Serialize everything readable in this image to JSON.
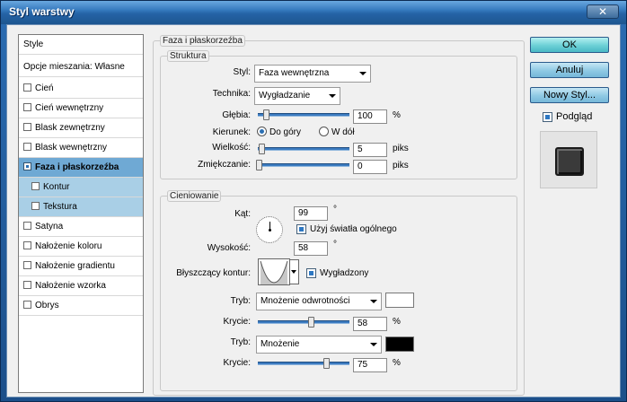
{
  "window": {
    "title": "Styl warstwy",
    "close_symbol": "✕"
  },
  "list": {
    "header": "Style",
    "blending": "Opcje mieszania: Własne",
    "items": [
      {
        "label": "Cień"
      },
      {
        "label": "Cień wewnętrzny"
      },
      {
        "label": "Blask zewnętrzny"
      },
      {
        "label": "Blask wewnętrzny"
      },
      {
        "label": "Faza i płaskorzeźba"
      },
      {
        "label": "Kontur"
      },
      {
        "label": "Tekstura"
      },
      {
        "label": "Satyna"
      },
      {
        "label": "Nałożenie koloru"
      },
      {
        "label": "Nałożenie gradientu"
      },
      {
        "label": "Nałożenie wzorka"
      },
      {
        "label": "Obrys"
      }
    ]
  },
  "bevel": {
    "title": "Faza i płaskorzeźba",
    "structure": {
      "title": "Struktura",
      "style_label": "Styl:",
      "style_value": "Faza wewnętrzna",
      "technique_label": "Technika:",
      "technique_value": "Wygładzanie",
      "depth_label": "Głębia:",
      "depth_value": "100",
      "depth_unit": "%",
      "direction_label": "Kierunek:",
      "dir_up": "Do góry",
      "dir_down": "W dół",
      "size_label": "Wielkość:",
      "size_value": "5",
      "size_unit": "piks",
      "soften_label": "Zmiękczanie:",
      "soften_value": "0",
      "soften_unit": "piks"
    },
    "shading": {
      "title": "Cieniowanie",
      "angle_label": "Kąt:",
      "angle_value": "99",
      "angle_unit": "°",
      "global_light_label": "Użyj światła ogólnego",
      "altitude_label": "Wysokość:",
      "altitude_value": "58",
      "altitude_unit": "°",
      "gloss_label": "Błyszczący kontur:",
      "antialiased_label": "Wygładzony",
      "highlight_mode_label": "Tryb:",
      "highlight_mode_value": "Mnożenie odwrotności",
      "highlight_opacity_label": "Krycie:",
      "highlight_opacity_value": "58",
      "highlight_opacity_unit": "%",
      "shadow_mode_label": "Tryb:",
      "shadow_mode_value": "Mnożenie",
      "shadow_opacity_label": "Krycie:",
      "shadow_opacity_value": "75",
      "shadow_opacity_unit": "%",
      "highlight_color": "#ffffff",
      "shadow_color": "#000000"
    }
  },
  "buttons": {
    "ok": "OK",
    "cancel": "Anuluj",
    "new_style": "Nowy Styl...",
    "preview_label": "Podgląd"
  }
}
